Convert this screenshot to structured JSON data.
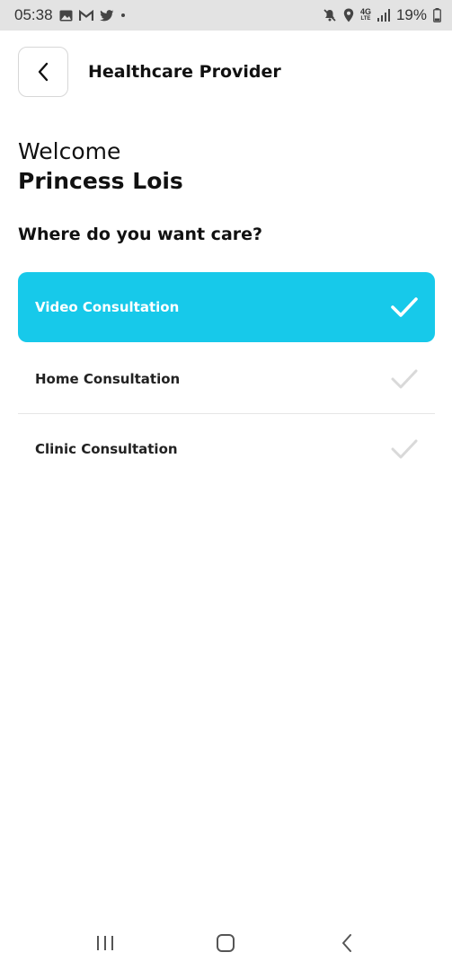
{
  "status_bar": {
    "time": "05:38",
    "network_label": "4G",
    "network_sub": "LTE",
    "battery": "19%",
    "icons": [
      "gallery-icon",
      "gmail-icon",
      "twitter-icon",
      "dot-icon",
      "mute-icon",
      "location-icon",
      "signal-icon",
      "battery-icon"
    ]
  },
  "header": {
    "title": "Healthcare Provider",
    "back_icon": "chevron-left-icon"
  },
  "welcome": {
    "greeting": "Welcome",
    "name": "Princess Lois"
  },
  "question": "Where do you want care?",
  "options": [
    {
      "label": "Video Consultation",
      "selected": true
    },
    {
      "label": "Home Consultation",
      "selected": false
    },
    {
      "label": "Clinic Consultation",
      "selected": false
    }
  ],
  "colors": {
    "accent": "#17c9ea",
    "check_unselected": "#d9d9d9",
    "divider": "#e6e6e6"
  },
  "nav": {
    "recents_icon": "recents-icon",
    "home_icon": "home-icon",
    "back_icon": "back-icon"
  }
}
